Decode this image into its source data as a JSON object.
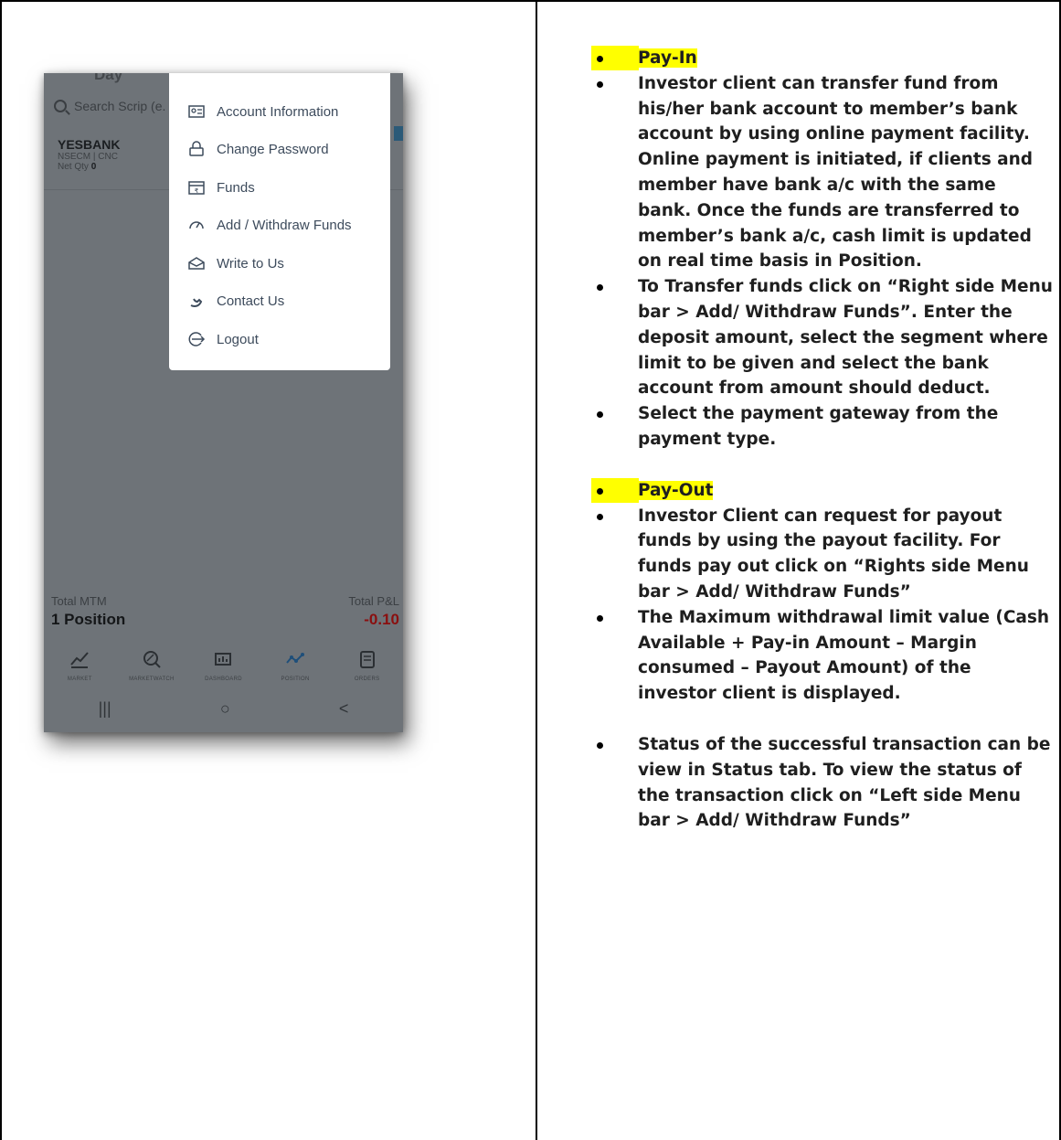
{
  "phone": {
    "top_partial_text": "Day",
    "search_placeholder": "Search Scrip (e.",
    "scrip": {
      "name": "YESBANK",
      "segment": "NSECM | CNC",
      "net_qty_label": "Net Qty",
      "net_qty_value": "0"
    },
    "totals": {
      "mtm_label": "Total MTM",
      "position_value": "1 Position",
      "pl_label": "Total P&L",
      "pl_value": "-0.10"
    },
    "bottom_nav": [
      {
        "label": "MARKET",
        "icon": "trend-up-icon"
      },
      {
        "label": "MARKETWATCH",
        "icon": "watch-search-icon"
      },
      {
        "label": "DASHBOARD",
        "icon": "dashboard-icon"
      },
      {
        "label": "POSITION",
        "icon": "position-icon"
      },
      {
        "label": "ORDERS",
        "icon": "orders-icon"
      }
    ],
    "system_nav": [
      "|||",
      "○",
      "<"
    ],
    "menu": [
      {
        "label": "Account Information",
        "icon": "account-info-icon"
      },
      {
        "label": "Change Password",
        "icon": "change-password-icon"
      },
      {
        "label": "Funds",
        "icon": "funds-icon"
      },
      {
        "label": "Add / Withdraw Funds",
        "icon": "add-withdraw-icon"
      },
      {
        "label": "Write to Us",
        "icon": "mail-icon"
      },
      {
        "label": "Contact Us",
        "icon": "phone-icon"
      },
      {
        "label": "Logout",
        "icon": "logout-icon"
      }
    ]
  },
  "doc": {
    "payin_heading": "Pay-In",
    "payin_bullets": [
      "Investor client can transfer fund from his/her bank account to member’s bank account by using online payment facility. Online payment is initiated, if clients and member have bank a/c with the same bank. Once the funds are transferred to member’s bank a/c, cash limit is updated on real time basis in Position.",
      "To Transfer funds click on “Right side Menu bar > Add/ Withdraw Funds”. Enter the deposit amount, select the segment where limit to be given and select the bank account from amount should deduct.",
      "Select the payment gateway from the payment type."
    ],
    "payout_heading": "Pay-Out",
    "payout_bullets": [
      "Investor Client can request for payout funds by using the payout facility. For funds pay out click on “Rights side Menu bar > Add/ Withdraw Funds”",
      "The Maximum withdrawal limit value (Cash Available + Pay-in Amount – Margin consumed – Payout Amount) of the investor client is displayed.",
      "Status of the successful transaction can be view in Status tab. To view the status of the transaction click on “Left side Menu bar > Add/ Withdraw Funds”"
    ]
  }
}
